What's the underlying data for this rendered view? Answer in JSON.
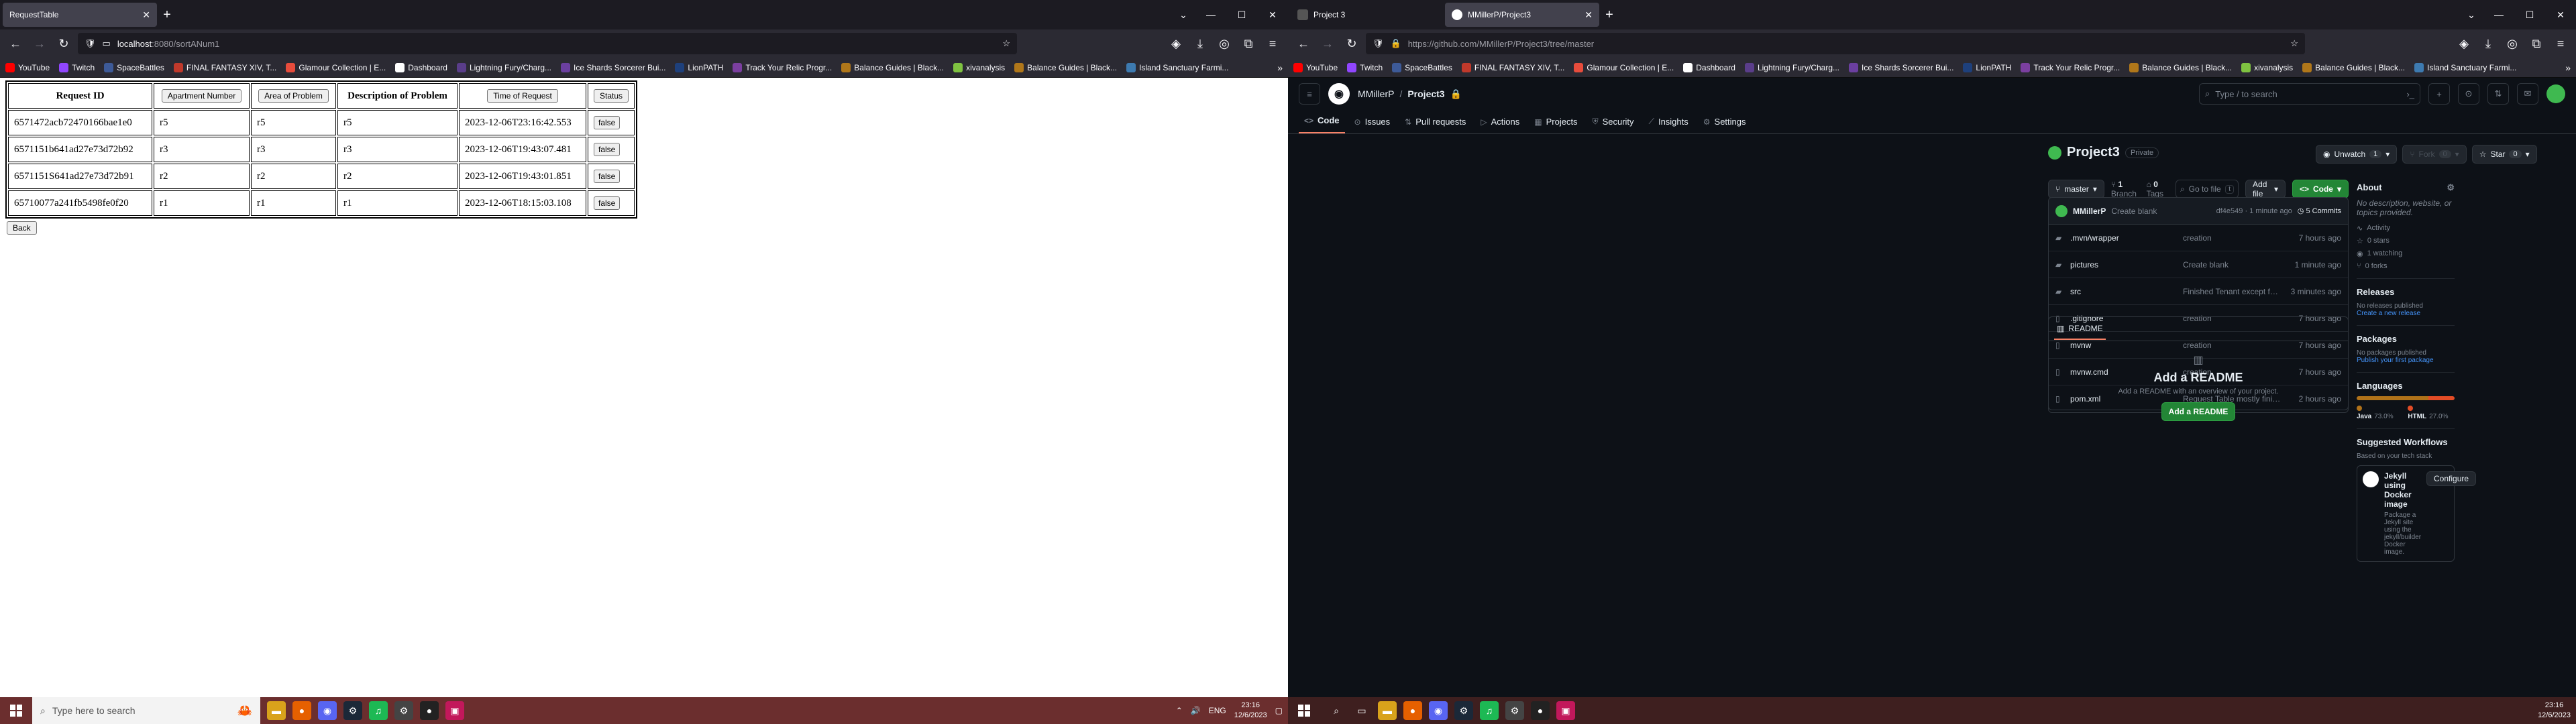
{
  "left": {
    "tab": {
      "title": "RequestTable"
    },
    "url": {
      "host": "localhost",
      "rest": ":8080/sortANum1"
    },
    "bookmarks": [
      "YouTube",
      "Twitch",
      "SpaceBattles",
      "FINAL FANTASY XIV, T...",
      "Glamour Collection | E...",
      "Dashboard",
      "Lightning Fury/Charg...",
      "Ice Shards Sorcerer Bui...",
      "LionPATH",
      "Track Your Relic Progr...",
      "Balance Guides | Black...",
      "xivanalysis",
      "Balance Guides | Black...",
      "Island Sanctuary Farmi..."
    ],
    "table": {
      "headers": {
        "id": "Request ID",
        "apt": "Apartment Number",
        "area": "Area of Problem",
        "desc": "Description of Problem",
        "time": "Time of Request",
        "status": "Status"
      },
      "rows": [
        {
          "id": "6571472acb72470166bae1e0",
          "apt": "r5",
          "area": "r5",
          "desc": "r5",
          "time": "2023-12-06T23:16:42.553",
          "status": "false"
        },
        {
          "id": "6571151b641ad27e73d72b92",
          "apt": "r3",
          "area": "r3",
          "desc": "r3",
          "time": "2023-12-06T19:43:07.481",
          "status": "false"
        },
        {
          "id": "6571151S641ad27e73d72b91",
          "apt": "r2",
          "area": "r2",
          "desc": "r2",
          "time": "2023-12-06T19:43:01.851",
          "status": "false"
        },
        {
          "id": "65710077a241fb5498fe0f20",
          "apt": "r1",
          "area": "r1",
          "desc": "r1",
          "time": "2023-12-06T18:15:03.108",
          "status": "false"
        }
      ]
    },
    "back_label": "Back",
    "taskbar": {
      "search_placeholder": "Type here to search",
      "lang": "ENG",
      "time": "23:16",
      "date": "12/6/2023"
    }
  },
  "right": {
    "tabs": [
      {
        "title": "Project 3"
      },
      {
        "title": "MMillerP/Project3"
      }
    ],
    "url": {
      "text": "https://github.com/MMillerP/Project3/tree/master"
    },
    "bookmarks": [
      "YouTube",
      "Twitch",
      "SpaceBattles",
      "FINAL FANTASY XIV, T...",
      "Glamour Collection | E...",
      "Dashboard",
      "Lightning Fury/Charg...",
      "Ice Shards Sorcerer Bui...",
      "LionPATH",
      "Track Your Relic Progr...",
      "Balance Guides | Black...",
      "xivanalysis",
      "Balance Guides | Black...",
      "Island Sanctuary Farmi..."
    ],
    "github": {
      "owner": "MMillerP",
      "repo": "Project3",
      "search_placeholder": "Type / to search",
      "tabs": [
        "Code",
        "Issues",
        "Pull requests",
        "Actions",
        "Projects",
        "Security",
        "Insights",
        "Settings"
      ],
      "visibility": "Private",
      "unwatch": "Unwatch",
      "unwatch_count": "1",
      "fork": "Fork",
      "fork_count": "0",
      "star": "Star",
      "star_count": "0",
      "branch": "master",
      "branches": "1",
      "branches_label": "Branch",
      "tags": "0",
      "tags_label": "Tags",
      "goto": "Go to file",
      "goto_kbd": "t",
      "add_file": "Add file",
      "code_btn": "Code",
      "commit": {
        "author": "MMillerP",
        "message": "Create blank",
        "meta": "df4e549 · 1 minute ago",
        "count": "5 Commits"
      },
      "files": [
        {
          "name": ".mvn/wrapper",
          "type": "folder",
          "msg": "creation",
          "time": "7 hours ago"
        },
        {
          "name": "pictures",
          "type": "folder",
          "msg": "Create blank",
          "time": "1 minute ago"
        },
        {
          "name": "src",
          "type": "folder",
          "msg": "Finished Tenant except for update Apartment - will not conn...",
          "time": "3 minutes ago"
        },
        {
          "name": ".gitignore",
          "type": "file",
          "msg": "creation",
          "time": "7 hours ago"
        },
        {
          "name": "mvnw",
          "type": "file",
          "msg": "creation",
          "time": "7 hours ago"
        },
        {
          "name": "mvnw.cmd",
          "type": "file",
          "msg": "creation",
          "time": "7 hours ago"
        },
        {
          "name": "pom.xml",
          "type": "file",
          "msg": "Request Table mostly finished - needs images,status update f...",
          "time": "2 hours ago"
        }
      ],
      "readme": {
        "tab": "README",
        "title": "Add a README",
        "text": "Add a README with an overview of your project.",
        "button": "Add a README"
      },
      "about": {
        "title": "About",
        "description": "No description, website, or topics provided.",
        "activity": "Activity",
        "stars": "0 stars",
        "watching": "1 watching",
        "forks": "0 forks"
      },
      "releases": {
        "title": "Releases",
        "text": "No releases published",
        "link": "Create a new release"
      },
      "packages": {
        "title": "Packages",
        "text": "No packages published",
        "link": "Publish your first package"
      },
      "languages": {
        "title": "Languages",
        "items": [
          {
            "name": "Java",
            "pct": "73.0%",
            "value": 73.0,
            "color": "#b07219"
          },
          {
            "name": "HTML",
            "pct": "27.0%",
            "value": 27.0,
            "color": "#e34c26"
          }
        ]
      },
      "workflows": {
        "title": "Suggested Workflows",
        "subtitle": "Based on your tech stack",
        "card_title": "Jekyll using Docker image",
        "card_text": "Package a Jekyll site using the jekyll/builder Docker image.",
        "configure": "Configure"
      }
    },
    "taskbar": {
      "time": "23:16",
      "date": "12/6/2023"
    }
  }
}
